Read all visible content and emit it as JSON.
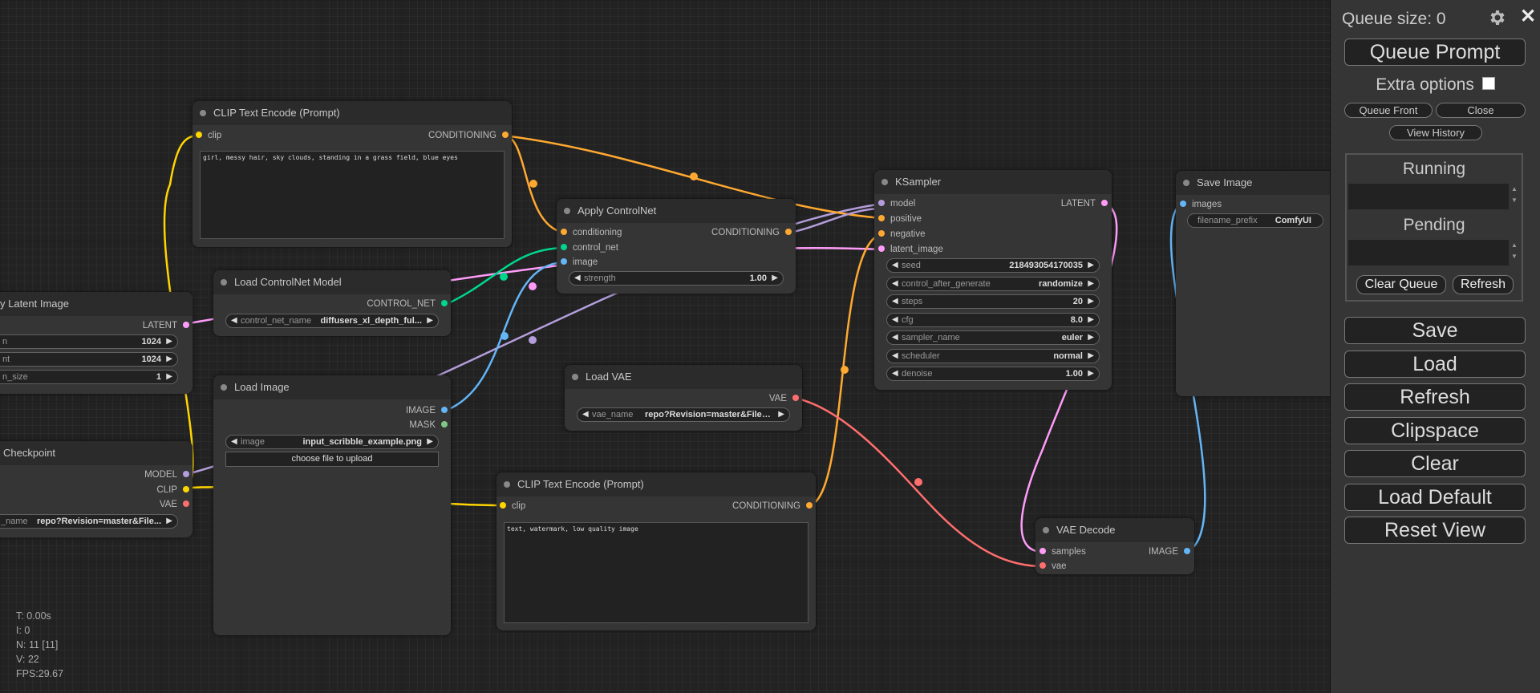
{
  "canvas": {
    "nodes": {
      "clip_pos": {
        "title": "CLIP Text Encode (Prompt)",
        "in_clip": "clip",
        "out": "CONDITIONING",
        "text": "girl, messy hair, sky clouds, standing in a grass field, blue eyes"
      },
      "latent": {
        "title": "y Latent Image",
        "out": "LATENT",
        "w1_label": "n",
        "w1_value": "1024",
        "w2_label": "nt",
        "w2_value": "1024",
        "w3_label": "n_size",
        "w3_value": "1"
      },
      "checkpoint": {
        "title": "Checkpoint",
        "out_model": "MODEL",
        "out_clip": "CLIP",
        "out_vae": "VAE",
        "w_label": "_name",
        "w_value": "repo?Revision=master&File..."
      },
      "cn_model": {
        "title": "Load ControlNet Model",
        "out": "CONTROL_NET",
        "w_label": "control_net_name",
        "w_value": "diffusers_xl_depth_ful..."
      },
      "load_image": {
        "title": "Load Image",
        "out_image": "IMAGE",
        "out_mask": "MASK",
        "w_label": "image",
        "w_value": "input_scribble_example.png",
        "upload": "choose file to upload"
      },
      "apply_cn": {
        "title": "Apply ControlNet",
        "in_cond": "conditioning",
        "in_cn": "control_net",
        "in_image": "image",
        "out": "CONDITIONING",
        "w_label": "strength",
        "w_value": "1.00"
      },
      "load_vae": {
        "title": "Load VAE",
        "out": "VAE",
        "w_label": "vae_name",
        "w_value": "repo?Revision=master&FileP..."
      },
      "clip_neg": {
        "title": "CLIP Text Encode (Prompt)",
        "in_clip": "clip",
        "out": "CONDITIONING",
        "text": "text, watermark, low quality image"
      },
      "ksampler": {
        "title": "KSampler",
        "in_model": "model",
        "in_pos": "positive",
        "in_neg": "negative",
        "in_latent": "latent_image",
        "out": "LATENT",
        "widgets": [
          {
            "label": "seed",
            "value": "218493054170035"
          },
          {
            "label": "control_after_generate",
            "value": "randomize"
          },
          {
            "label": "steps",
            "value": "20"
          },
          {
            "label": "cfg",
            "value": "8.0"
          },
          {
            "label": "sampler_name",
            "value": "euler"
          },
          {
            "label": "scheduler",
            "value": "normal"
          },
          {
            "label": "denoise",
            "value": "1.00"
          }
        ]
      },
      "vae_decode": {
        "title": "VAE Decode",
        "in_samples": "samples",
        "in_vae": "vae",
        "out": "IMAGE"
      },
      "save_image": {
        "title": "Save Image",
        "in_images": "images",
        "w_label": "filename_prefix",
        "w_value": "ComfyUI"
      }
    },
    "stats": {
      "t": "T: 0.00s",
      "i": "I: 0",
      "n": "N: 11 [11]",
      "v": "V: 22",
      "fps": "FPS:29.67"
    },
    "colors": {
      "model": "#b39ddb",
      "clip": "#ffd500",
      "conditioning": "#ffa931",
      "control_net": "#00d78d",
      "image": "#64b5f6",
      "latent": "#ff9cf9",
      "vae": "#ff6e6e",
      "mask": "#81c784"
    }
  },
  "menu": {
    "queue_size": "Queue size: 0",
    "queue_prompt": "Queue Prompt",
    "extra_options": "Extra options",
    "queue_front": "Queue Front",
    "close": "Close",
    "view_history": "View History",
    "running": "Running",
    "pending": "Pending",
    "clear_queue": "Clear Queue",
    "refresh_small": "Refresh",
    "save": "Save",
    "load": "Load",
    "refresh": "Refresh",
    "clipspace": "Clipspace",
    "clear": "Clear",
    "load_default": "Load Default",
    "reset_view": "Reset View",
    "gear_icon": "gear-icon",
    "close_icon": "close-icon"
  }
}
